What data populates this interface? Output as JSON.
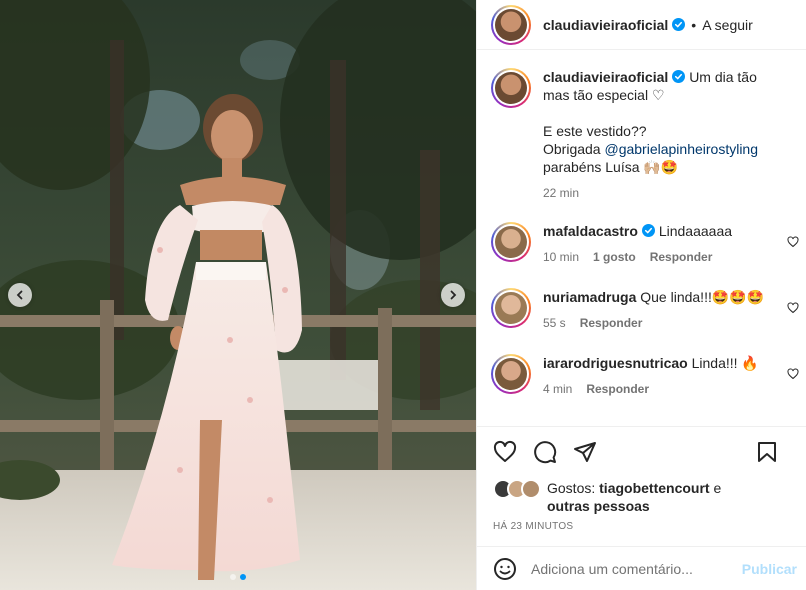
{
  "media": {
    "carousel_dots": 2,
    "active_dot": 1
  },
  "header": {
    "username": "claudiavieiraoficial",
    "separator": "•",
    "follow_label": "A seguir"
  },
  "caption": {
    "username": "claudiavieiraoficial",
    "line1": "Um dia tão mas tão especial ♡",
    "line2": "E este vestido??",
    "line3_prefix": "Obrigada ",
    "mention": "@gabrielapinheirostyling",
    "line4": "parabéns Luísa 🙌🏼🤩",
    "time": "22 min"
  },
  "comments": [
    {
      "username": "mafaldacastro",
      "verified": true,
      "text": "Lindaaaaaa",
      "time": "10 min",
      "likes": "1 gosto",
      "reply": "Responder"
    },
    {
      "username": "nuriamadruga",
      "verified": false,
      "text": "Que linda!!!🤩🤩🤩",
      "time": "55 s",
      "likes": "",
      "reply": "Responder"
    },
    {
      "username": "iararodriguesnutricao",
      "verified": false,
      "text": "Linda!!! 🔥",
      "time": "4 min",
      "likes": "",
      "reply": "Responder"
    }
  ],
  "likes": {
    "prefix": "Gostos: ",
    "user": "tiagobettencourt",
    "suffix": " e ",
    "others": "outras pessoas"
  },
  "timeago": "HÁ 23 MINUTOS",
  "composer": {
    "placeholder": "Adiciona um comentário...",
    "publish": "Publicar"
  },
  "colors": {
    "verified": "#0095f6",
    "mention": "#00376b",
    "publish_disabled": "#b2dffc"
  }
}
